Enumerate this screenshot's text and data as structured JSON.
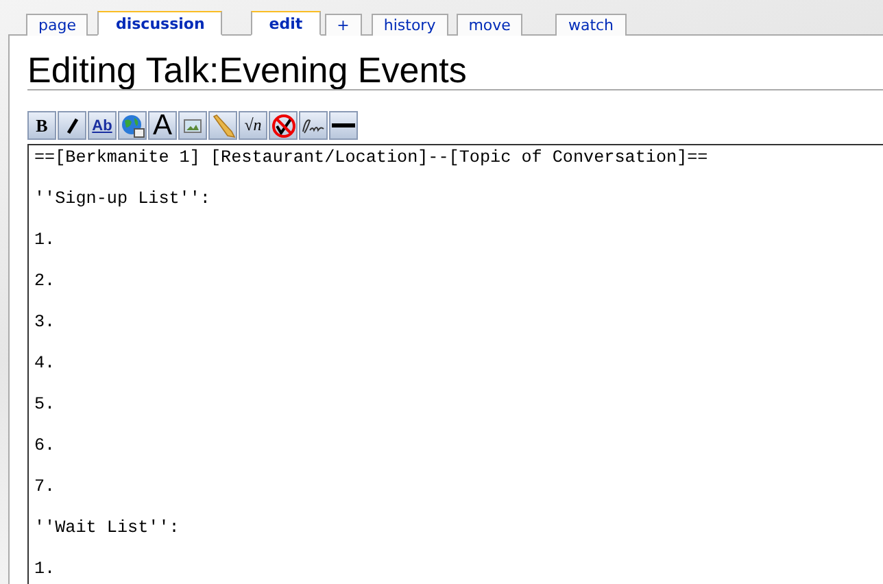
{
  "tabs": [
    {
      "label": "page",
      "selected": false
    },
    {
      "label": "discussion",
      "selected": true
    },
    {
      "label": "edit",
      "selected": true
    },
    {
      "label": "+",
      "selected": false
    },
    {
      "label": "history",
      "selected": false
    },
    {
      "label": "move",
      "selected": false
    },
    {
      "label": "watch",
      "selected": false
    }
  ],
  "heading": "Editing Talk:Evening Events",
  "toolbar": [
    {
      "kind": "bold",
      "label": "B"
    },
    {
      "kind": "italic"
    },
    {
      "kind": "link",
      "label": "Ab"
    },
    {
      "kind": "globe"
    },
    {
      "kind": "headline",
      "label": "A"
    },
    {
      "kind": "image"
    },
    {
      "kind": "media"
    },
    {
      "kind": "math",
      "label": "√n"
    },
    {
      "kind": "nowiki"
    },
    {
      "kind": "signature"
    },
    {
      "kind": "rule"
    }
  ],
  "editor_lines": [
    "==[Berkmanite 1] [Restaurant/Location]--[Topic of Conversation]==",
    "''Sign-up List'':",
    "1.",
    "2.",
    "3.",
    "4.",
    "5.",
    "6.",
    "7.",
    "''Wait List'':",
    "1."
  ]
}
